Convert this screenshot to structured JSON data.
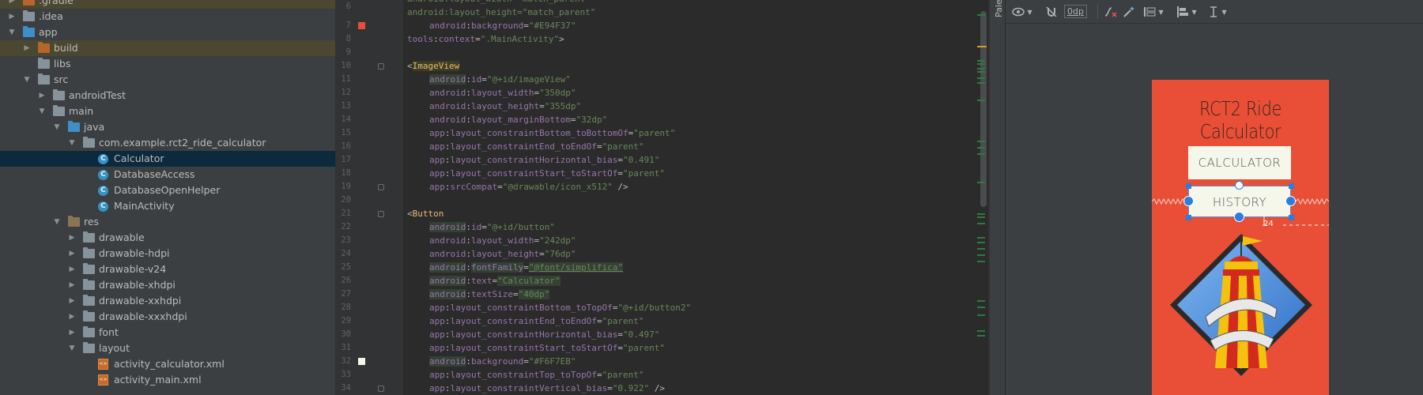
{
  "project_tree": {
    "items": [
      {
        "label": ".gradle",
        "icon": "folder-orange-icon",
        "expanded": false
      },
      {
        "label": ".idea",
        "icon": "folder-icon",
        "expanded": false
      },
      {
        "label": "app",
        "icon": "module-folder-icon",
        "expanded": true
      },
      {
        "label": "build",
        "icon": "folder-orange-icon",
        "expanded": false
      },
      {
        "label": "libs",
        "icon": "folder-icon"
      },
      {
        "label": "src",
        "icon": "folder-icon",
        "expanded": true
      },
      {
        "label": "androidTest",
        "icon": "folder-icon",
        "expanded": false
      },
      {
        "label": "main",
        "icon": "folder-icon",
        "expanded": true
      },
      {
        "label": "java",
        "icon": "folder-blue-icon",
        "expanded": true
      },
      {
        "label": "com.example.rct2_ride_calculator",
        "icon": "package-folder-icon",
        "expanded": true
      },
      {
        "label": "Calculator",
        "icon": "class-icon",
        "selected": true
      },
      {
        "label": "DatabaseAccess",
        "icon": "class-icon"
      },
      {
        "label": "DatabaseOpenHelper",
        "icon": "class-icon"
      },
      {
        "label": "MainActivity",
        "icon": "class-icon"
      },
      {
        "label": "res",
        "icon": "resource-folder-icon",
        "expanded": true
      },
      {
        "label": "drawable",
        "icon": "folder-icon",
        "expanded": false
      },
      {
        "label": "drawable-hdpi",
        "icon": "folder-icon",
        "expanded": false
      },
      {
        "label": "drawable-v24",
        "icon": "folder-icon",
        "expanded": false
      },
      {
        "label": "drawable-xhdpi",
        "icon": "folder-icon",
        "expanded": false
      },
      {
        "label": "drawable-xxhdpi",
        "icon": "folder-icon",
        "expanded": false
      },
      {
        "label": "drawable-xxxhdpi",
        "icon": "folder-icon",
        "expanded": false
      },
      {
        "label": "font",
        "icon": "folder-icon",
        "expanded": false
      },
      {
        "label": "layout",
        "icon": "folder-icon",
        "expanded": true
      },
      {
        "label": "activity_calculator.xml",
        "icon": "xml-file-icon"
      },
      {
        "label": "activity_main.xml",
        "icon": "xml-file-icon"
      }
    ]
  },
  "editor": {
    "lines": [
      {
        "n": "7",
        "text": "android:background=\"#E94F37\""
      },
      {
        "n": "8",
        "text": "tools:context=\".MainActivity\">"
      },
      {
        "n": "9",
        "text": ""
      },
      {
        "n": "10",
        "text": "<ImageView"
      },
      {
        "n": "11",
        "text": "android:id=\"@+id/imageView\""
      },
      {
        "n": "12",
        "text": "android:layout_width=\"350dp\""
      },
      {
        "n": "13",
        "text": "android:layout_height=\"355dp\""
      },
      {
        "n": "14",
        "text": "android:layout_marginBottom=\"32dp\""
      },
      {
        "n": "15",
        "text": "app:layout_constraintBottom_toBottomOf=\"parent\""
      },
      {
        "n": "16",
        "text": "app:layout_constraintEnd_toEndOf=\"parent\""
      },
      {
        "n": "17",
        "text": "app:layout_constraintHorizontal_bias=\"0.491\""
      },
      {
        "n": "18",
        "text": "app:layout_constraintStart_toStartOf=\"parent\""
      },
      {
        "n": "19",
        "text": "app:srcCompat=\"@drawable/icon_x512\" />"
      },
      {
        "n": "20",
        "text": ""
      },
      {
        "n": "21",
        "text": "<Button"
      },
      {
        "n": "22",
        "text": "android:id=\"@+id/button\""
      },
      {
        "n": "23",
        "text": "android:layout_width=\"242dp\""
      },
      {
        "n": "24",
        "text": "android:layout_height=\"76dp\""
      },
      {
        "n": "25",
        "text": "android:fontFamily=\"@font/simplifica\""
      },
      {
        "n": "26",
        "text": "android:text=\"Calculator\""
      },
      {
        "n": "27",
        "text": "android:textSize=\"40dp\""
      },
      {
        "n": "28",
        "text": "app:layout_constraintBottom_toTopOf=\"@+id/button2\""
      },
      {
        "n": "29",
        "text": "app:layout_constraintEnd_toEndOf=\"parent\""
      },
      {
        "n": "30",
        "text": "app:layout_constraintHorizontal_bias=\"0.497\""
      },
      {
        "n": "31",
        "text": "app:layout_constraintStart_toStartOf=\"parent\""
      },
      {
        "n": "32",
        "text": "android:background=\"#F6F7EB\""
      },
      {
        "n": "33",
        "text": "app:layout_constraintTop_toTopOf=\"parent\""
      },
      {
        "n": "34",
        "text": "app:layout_constraintVertical_bias=\"0.922\" />"
      }
    ],
    "partial_top_lines": [
      "android:layout_width=\"match_parent\"",
      "android:layout_height=\"match_parent\""
    ],
    "line_number_6": "6",
    "color_swatches": {
      "line7": "#E94F37",
      "line32": "#F6F7EB"
    }
  },
  "palette_tab": "Palette",
  "design_toolbar": {
    "margin_value": "0dp",
    "icons": [
      "eye-icon",
      "magnet-off-icon",
      "clear-constraints-icon",
      "magic-wand-icon",
      "pack-icon",
      "align-icon",
      "guidelines-icon"
    ]
  },
  "preview": {
    "background": "#E94F37",
    "title": "RCT2 Ride Calculator",
    "calculator_button": "CALCULATOR",
    "history_button": "HISTORY",
    "margin_badge": "24",
    "button_background": "#F6F7EB"
  }
}
